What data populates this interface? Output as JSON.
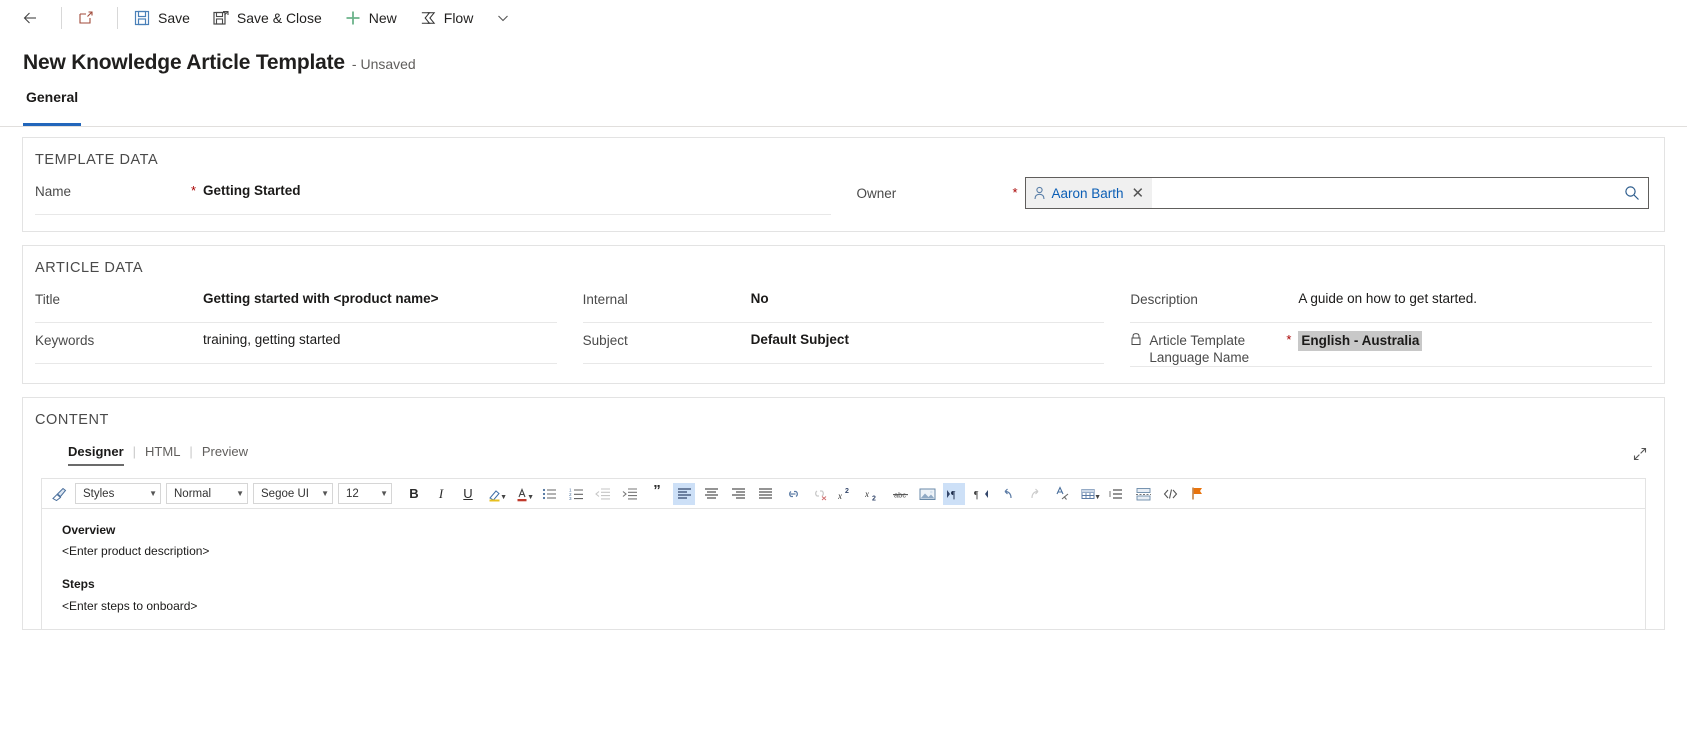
{
  "commandbar": {
    "back_label": "",
    "open_label": "",
    "save_label": "Save",
    "save_close_label": "Save & Close",
    "new_label": "New",
    "flow_label": "Flow",
    "flow_caret": "⌄"
  },
  "header": {
    "title": "New Knowledge Article Template",
    "subtitle": "- Unsaved"
  },
  "tabs": [
    {
      "label": "General",
      "active": true
    }
  ],
  "sections": {
    "template_data": {
      "heading": "TEMPLATE DATA",
      "fields": {
        "name": {
          "label": "Name",
          "required": "*",
          "value": "Getting Started"
        },
        "owner": {
          "label": "Owner",
          "required": "*",
          "value": "Aaron Barth",
          "remove_label": "✕"
        }
      }
    },
    "article_data": {
      "heading": "ARTICLE DATA",
      "fields": {
        "title": {
          "label": "Title",
          "value": "Getting started with <product name>"
        },
        "keywords": {
          "label": "Keywords",
          "value": "training, getting started"
        },
        "internal": {
          "label": "Internal",
          "value": "No"
        },
        "subject": {
          "label": "Subject",
          "value": "Default Subject"
        },
        "description": {
          "label": "Description",
          "value": "A guide on how to get started."
        },
        "language": {
          "label_line1": "Article Template",
          "label_line2": "Language Name",
          "required": "*",
          "value": "English - Australia"
        }
      }
    },
    "content": {
      "heading": "CONTENT",
      "editor_tabs": [
        {
          "label": "Designer",
          "active": true
        },
        {
          "label": "HTML",
          "active": false
        },
        {
          "label": "Preview",
          "active": false
        }
      ],
      "tab_separator": "|",
      "toolbar": {
        "styles": "Styles",
        "format": "Normal",
        "font": "Segoe UI",
        "size": "12",
        "bold": "B",
        "italic": "I",
        "underline": "U",
        "superscript": "x",
        "subscript": "x",
        "quote": "”"
      },
      "body": {
        "overview_heading": "Overview",
        "overview_text": "<Enter product description>",
        "steps_heading": "Steps",
        "steps_text": "<Enter steps to onboard>"
      }
    }
  },
  "colors": {
    "accent_tab": "#2266bb",
    "required_asterisk": "#a80000",
    "link_blue": "#0b5eb5",
    "toolbar_selected": "#cde0f7",
    "highlight_grey": "#c8c8c8",
    "new_icon_green": "#6bb38a",
    "flag_orange": "#e8730c"
  }
}
